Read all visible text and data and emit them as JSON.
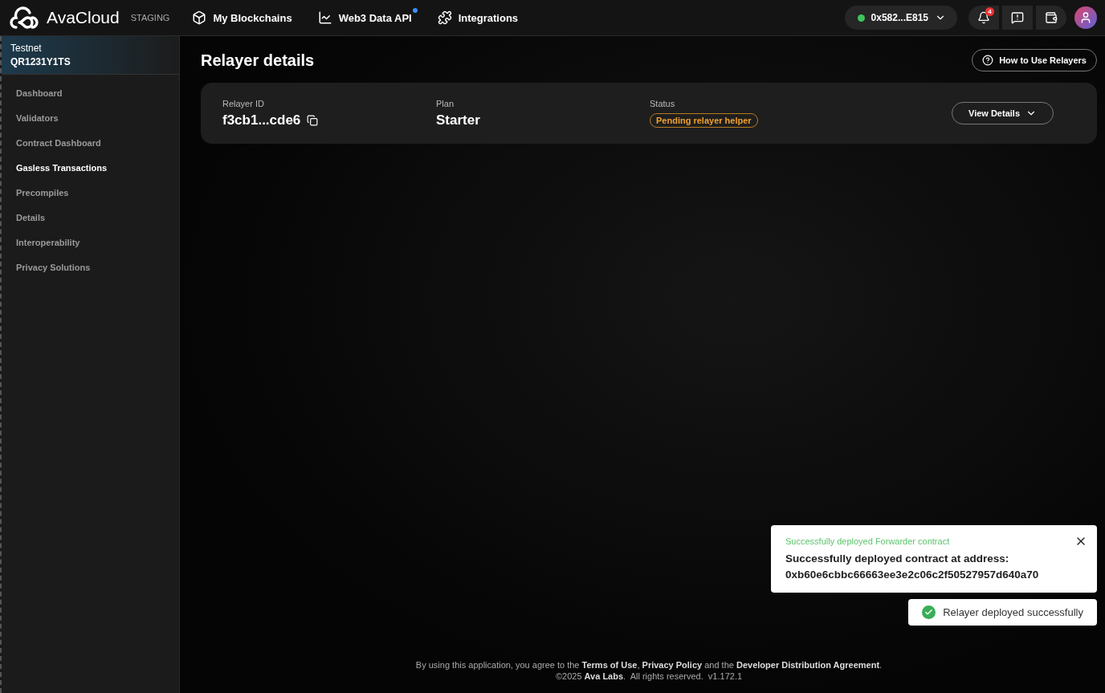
{
  "header": {
    "brand": "AvaCloud",
    "environment": "STAGING",
    "nav": [
      {
        "label": "My Blockchains",
        "dot": false
      },
      {
        "label": "Web3 Data API",
        "dot": true
      },
      {
        "label": "Integrations",
        "dot": false
      }
    ],
    "wallet": {
      "address": "0x582...E815",
      "connected": true
    },
    "notifications_count": "4"
  },
  "sidebar": {
    "network": "Testnet",
    "chain_id": "QR1231Y1TS",
    "items": [
      {
        "label": "Dashboard",
        "selected": false
      },
      {
        "label": "Validators",
        "selected": false
      },
      {
        "label": "Contract Dashboard",
        "selected": false
      },
      {
        "label": "Gasless Transactions",
        "selected": true
      },
      {
        "label": "Precompiles",
        "selected": false
      },
      {
        "label": "Details",
        "selected": false
      },
      {
        "label": "Interoperability",
        "selected": false
      },
      {
        "label": "Privacy Solutions",
        "selected": false
      }
    ]
  },
  "page": {
    "title": "Relayer details",
    "help_button": "How to Use Relayers",
    "relayer": {
      "id_label": "Relayer ID",
      "id": "f3cb1...cde6",
      "plan_label": "Plan",
      "plan": "Starter",
      "status_label": "Status",
      "status": "Pending relayer helper",
      "details_button": "View Details"
    }
  },
  "toasts": [
    {
      "kind": "detailed",
      "title": "Successfully deployed Forwarder contract",
      "message": "Successfully deployed contract at address:",
      "address": "0xb60e6cbbc66663ee3e2c06c2f50527957d640a70"
    },
    {
      "kind": "simple",
      "message": "Relayer deployed successfully"
    }
  ],
  "footer": {
    "line_1": "By using this application, you agree to the **Terms of Use**, **Privacy Policy** and the **Developer Distribution Agreement**.",
    "line_2": "©2025 **Ava Labs**.  All rights reserved.  v1.172.1"
  }
}
